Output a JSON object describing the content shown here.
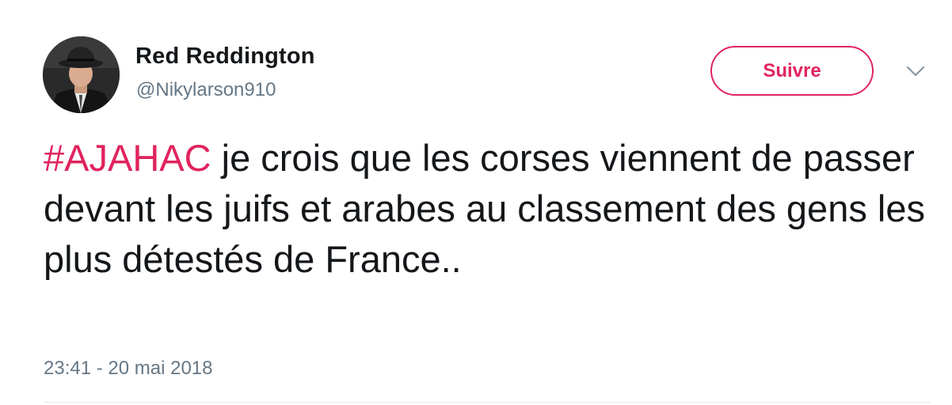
{
  "user": {
    "display_name": "Red Reddington",
    "handle": "@Nikylarson910"
  },
  "follow_button": {
    "label": "Suivre"
  },
  "tweet": {
    "hashtag": "#AJAHAC",
    "text": " je crois que les corses viennent de passer devant les juifs et arabes au classement des gens les plus détestés de France..",
    "timestamp": "23:41 - 20 mai 2018"
  },
  "icons": {
    "menu": "chevron-down-icon",
    "avatar": "avatar"
  },
  "colors": {
    "accent": "#e0245e",
    "text": "#14171a",
    "secondary": "#657786",
    "divider": "#e1e8ed"
  }
}
